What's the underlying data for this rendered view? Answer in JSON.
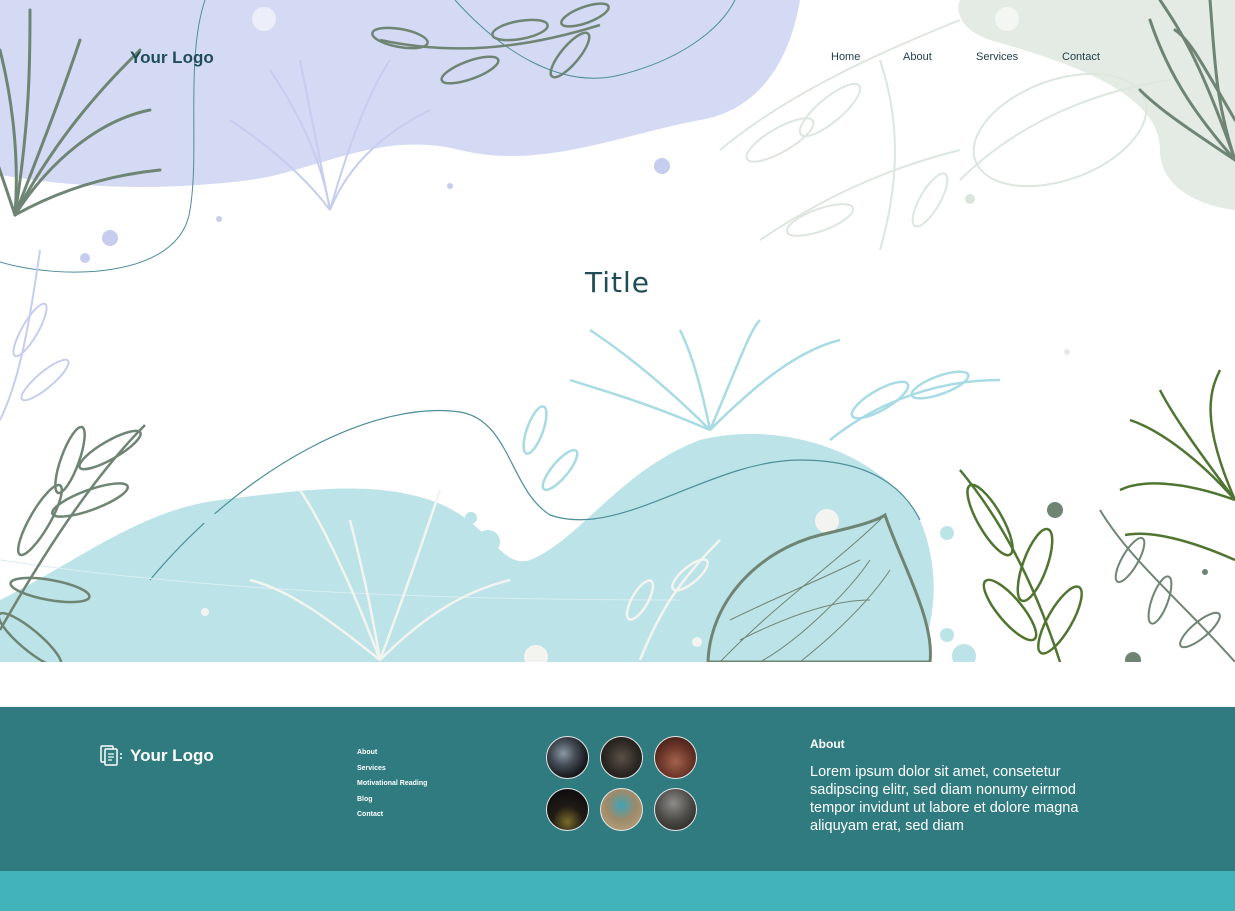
{
  "header": {
    "logo": "Your Logo",
    "nav": [
      {
        "label": "Home"
      },
      {
        "label": "About"
      },
      {
        "label": "Services"
      },
      {
        "label": "Contact"
      }
    ]
  },
  "hero": {
    "title": "Title"
  },
  "footer": {
    "logo": "Your Logo",
    "links": [
      {
        "label": "About"
      },
      {
        "label": "Services"
      },
      {
        "label": "Motivational Reading"
      },
      {
        "label": "Blog"
      },
      {
        "label": "Contact"
      }
    ],
    "gallery": [
      {
        "icon": "event-photo-1"
      },
      {
        "icon": "event-photo-2"
      },
      {
        "icon": "event-photo-3"
      },
      {
        "icon": "event-photo-4"
      },
      {
        "icon": "event-photo-5"
      },
      {
        "icon": "event-photo-6"
      }
    ],
    "about_heading": "About",
    "about_text": "Lorem ipsum dolor sit amet, consetetur sadipscing elitr, sed diam nonumy eirmod tempor invidunt ut labore et dolore magna aliquyam erat, sed diam"
  },
  "colors": {
    "footer_bg": "#2f7b80",
    "footer_bottom": "#42b3b9",
    "lavender": "#d4daf4",
    "aqua": "#bce3e8",
    "sage": "#6f8574",
    "olive": "#4f7530"
  }
}
